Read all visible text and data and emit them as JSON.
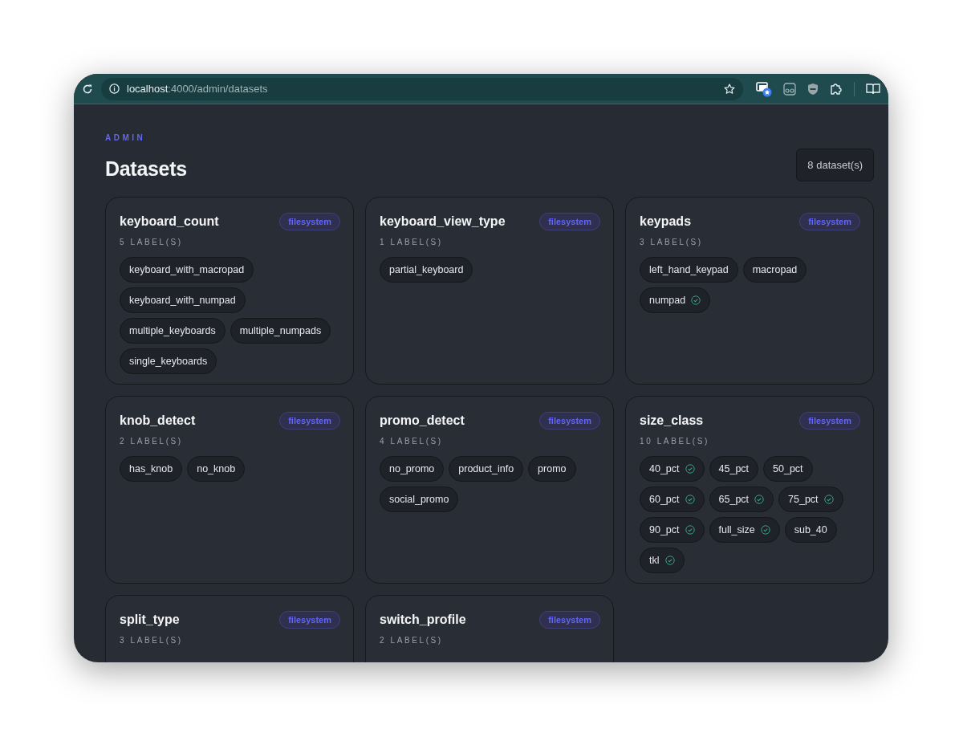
{
  "browser": {
    "url_host": "localhost",
    "url_path": ":4000/admin/datasets"
  },
  "header": {
    "eyebrow": "ADMIN",
    "title": "Datasets",
    "count": "8 dataset(s)"
  },
  "datasets": [
    {
      "name": "keyboard_count",
      "source": "filesystem",
      "count": "5 LABEL(S)",
      "labels": [
        {
          "text": "keyboard_with_macropad",
          "checked": false
        },
        {
          "text": "keyboard_with_numpad",
          "checked": false
        },
        {
          "text": "multiple_keyboards",
          "checked": false
        },
        {
          "text": "multiple_numpads",
          "checked": false
        },
        {
          "text": "single_keyboards",
          "checked": false
        }
      ]
    },
    {
      "name": "keyboard_view_type",
      "source": "filesystem",
      "count": "1 LABEL(S)",
      "labels": [
        {
          "text": "partial_keyboard",
          "checked": false
        }
      ]
    },
    {
      "name": "keypads",
      "source": "filesystem",
      "count": "3 LABEL(S)",
      "labels": [
        {
          "text": "left_hand_keypad",
          "checked": false
        },
        {
          "text": "macropad",
          "checked": false
        },
        {
          "text": "numpad",
          "checked": true
        }
      ]
    },
    {
      "name": "knob_detect",
      "source": "filesystem",
      "count": "2 LABEL(S)",
      "labels": [
        {
          "text": "has_knob",
          "checked": false
        },
        {
          "text": "no_knob",
          "checked": false
        }
      ]
    },
    {
      "name": "promo_detect",
      "source": "filesystem",
      "count": "4 LABEL(S)",
      "labels": [
        {
          "text": "no_promo",
          "checked": false
        },
        {
          "text": "product_info",
          "checked": false
        },
        {
          "text": "promo",
          "checked": false
        },
        {
          "text": "social_promo",
          "checked": false
        }
      ]
    },
    {
      "name": "size_class",
      "source": "filesystem",
      "count": "10 LABEL(S)",
      "labels": [
        {
          "text": "40_pct",
          "checked": true
        },
        {
          "text": "45_pct",
          "checked": false
        },
        {
          "text": "50_pct",
          "checked": false
        },
        {
          "text": "60_pct",
          "checked": true
        },
        {
          "text": "65_pct",
          "checked": true
        },
        {
          "text": "75_pct",
          "checked": true
        },
        {
          "text": "90_pct",
          "checked": true
        },
        {
          "text": "full_size",
          "checked": true
        },
        {
          "text": "sub_40",
          "checked": false
        },
        {
          "text": "tkl",
          "checked": true
        }
      ]
    },
    {
      "name": "split_type",
      "source": "filesystem",
      "count": "3 LABEL(S)"
    },
    {
      "name": "switch_profile",
      "source": "filesystem",
      "count": "2 LABEL(S)"
    }
  ]
}
